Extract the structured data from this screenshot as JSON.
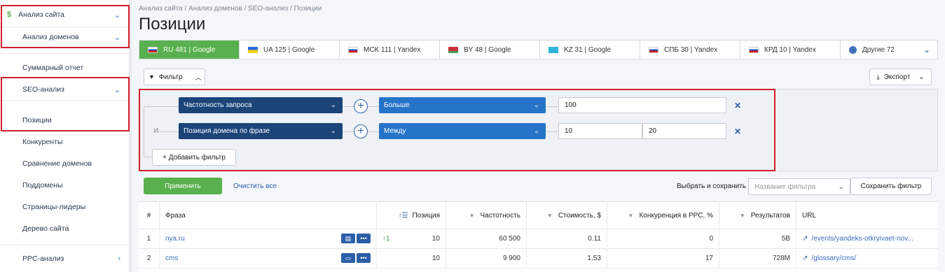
{
  "sidebar": {
    "site_analysis": "Анализ сайта",
    "domain_analysis": "Анализ доменов",
    "summary": "Суммарный отчет",
    "seo": "SEO-анализ",
    "positions": "Позиции",
    "competitors": "Конкуренты",
    "compare": "Сравнение доменов",
    "subdomains": "Поддомены",
    "leaders": "Страницы-лидеры",
    "tree": "Дерево сайта",
    "ppc": "PPC-анализ"
  },
  "breadcrumb": "Анализ сайта / Анализ доменов / SEO-анализ / Позиции",
  "title": "Позиции",
  "tabs": [
    {
      "label": "RU 481 | Google"
    },
    {
      "label": "UA 125 | Google"
    },
    {
      "label": "MCK 111 | Yandex"
    },
    {
      "label": "BY 48 | Google"
    },
    {
      "label": "KZ 31 | Google"
    },
    {
      "label": "СПБ 30 | Yandex"
    },
    {
      "label": "КРД 10 | Yandex"
    },
    {
      "label": "Другие 72"
    }
  ],
  "toolbar": {
    "filter": "Фильтр",
    "export": "Экспорт"
  },
  "filters": {
    "and_label": "И",
    "row1": {
      "field": "Частотность запроса",
      "op": "Больше",
      "value": "100"
    },
    "row2": {
      "field": "Позиция домена по фразе",
      "op": "Между",
      "from": "10",
      "to": "20"
    },
    "add": "+ Добавить фильтр"
  },
  "actions": {
    "apply": "Применить",
    "clear": "Очистить все",
    "choose_save": "Выбрать и сохранить",
    "filter_name_placeholder": "Название фильтра",
    "save_filter": "Сохранить фильтр"
  },
  "table": {
    "headers": [
      "#",
      "Фраза",
      "Позиция",
      "Частотность",
      "Стоимость, $",
      "Конкуренция в PPC, %",
      "Результатов",
      "URL"
    ],
    "rows": [
      {
        "n": "1",
        "phrase": "nya.ru",
        "change": "↑1",
        "pos": "10",
        "freq": "60 500",
        "cost": "0.11",
        "comp": "0",
        "results": "5B",
        "url": "/events/yandeks-otkryivaet-nov..."
      },
      {
        "n": "2",
        "phrase": "cms",
        "change": "",
        "pos": "10",
        "freq": "9 900",
        "cost": "1.53",
        "comp": "17",
        "results": "728M",
        "url": "/glossary/cms/"
      }
    ]
  }
}
